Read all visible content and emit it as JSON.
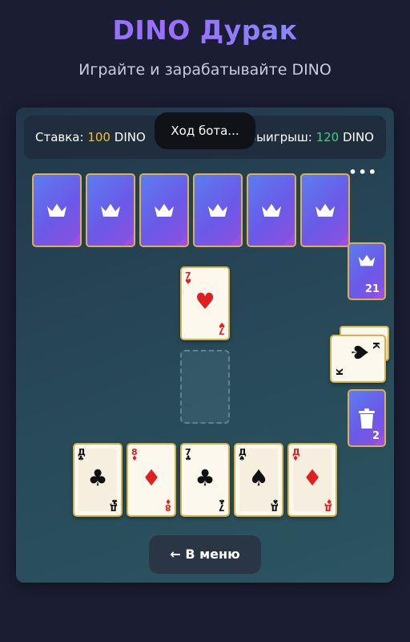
{
  "header": {
    "title": "DINO Дурак",
    "subtitle": "Играйте и зарабатывайте DINO"
  },
  "info": {
    "stake_label": "Ставка:",
    "stake_value": "100",
    "stake_currency": "DINO",
    "win_label": "Выигрыш:",
    "win_value": "120",
    "win_currency": "DINO"
  },
  "toast": "Ход бота...",
  "more_icon": "more-dots-icon",
  "opponent": {
    "cards_count": 6,
    "card_icon": "crown-icon"
  },
  "table": {
    "attack_card": {
      "rank": "7",
      "suit": "♥",
      "color": "red"
    }
  },
  "deck": {
    "count": "21",
    "icon": "crown-icon",
    "trump_card": {
      "rank": "К",
      "suit": "♠",
      "color": "black"
    }
  },
  "discard": {
    "count": "2",
    "icon": "trash-icon"
  },
  "hand": [
    {
      "rank": "Д",
      "suit": "♣",
      "color": "black"
    },
    {
      "rank": "8",
      "suit": "♦",
      "color": "red"
    },
    {
      "rank": "7",
      "suit": "♣",
      "color": "black"
    },
    {
      "rank": "Д",
      "suit": "♠",
      "color": "black"
    },
    {
      "rank": "Д",
      "suit": "♦",
      "color": "red"
    }
  ],
  "menu_button": {
    "arrow": "←",
    "label": "В меню"
  },
  "colors": {
    "background": "#1b1d33",
    "card_border": "#d8b24a",
    "stake": "#f2c230",
    "win": "#3fd27a",
    "card_back": "#6a5ae8"
  }
}
